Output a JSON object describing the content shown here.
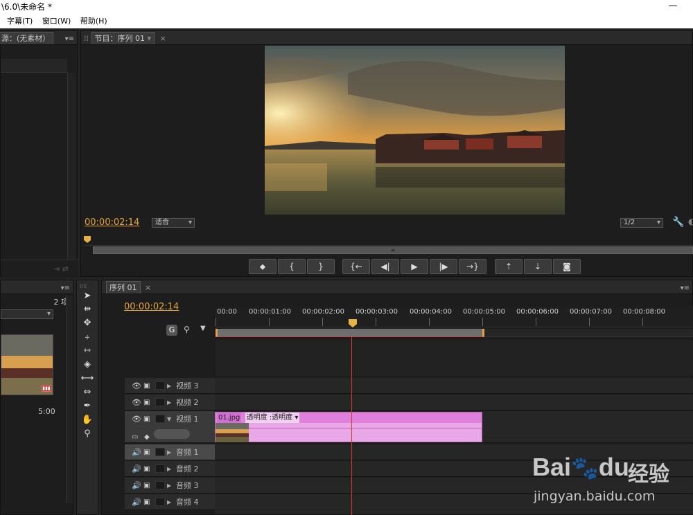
{
  "window": {
    "title": "\\6.0\\未命名 *",
    "minimize": "—"
  },
  "menu": [
    "字幕(T)",
    "窗口(W)",
    "帮助(H)"
  ],
  "source_panel": {
    "tab": "源：(无素材）"
  },
  "program_monitor": {
    "tab": "节目：序列 01",
    "timecode": "00:00:02:14",
    "fit": "适合",
    "quality": "1/2"
  },
  "transport_buttons": [
    {
      "name": "add-marker",
      "glyph": "⬥"
    },
    {
      "name": "mark-in",
      "glyph": "{"
    },
    {
      "name": "mark-out",
      "glyph": "}"
    },
    {
      "name": "go-to-in",
      "glyph": "{←"
    },
    {
      "name": "step-back",
      "glyph": "◀|"
    },
    {
      "name": "play",
      "glyph": "▶"
    },
    {
      "name": "step-forward",
      "glyph": "|▶"
    },
    {
      "name": "go-to-out",
      "glyph": "→}"
    },
    {
      "name": "lift",
      "glyph": "⇡"
    },
    {
      "name": "extract",
      "glyph": "⇣"
    },
    {
      "name": "export-frame",
      "glyph": "◙"
    }
  ],
  "project_panel": {
    "count": "2 项",
    "clip_duration": "5:00"
  },
  "timeline": {
    "tab": "序列 01",
    "timecode": "00:00:02:14",
    "ruler": [
      "00:00",
      "00:00:01:00",
      "00:00:02:00",
      "00:00:03:00",
      "00:00:04:00",
      "00:00:05:00",
      "00:00:06:00",
      "00:00:07:00",
      "00:00:08:00"
    ],
    "video_tracks": [
      "视频 3",
      "视频 2",
      "视频 1"
    ],
    "audio_tracks": [
      "音频 1",
      "音频 2",
      "音频 3",
      "音频 4"
    ],
    "clip": {
      "name": "01.jpg",
      "effect": "透明度 :透明度",
      "color": "#e58ce0"
    }
  },
  "watermark": {
    "brand": "Bai",
    "brand2": "du",
    "cn": "经验",
    "url": "jingyan.baidu.com"
  }
}
